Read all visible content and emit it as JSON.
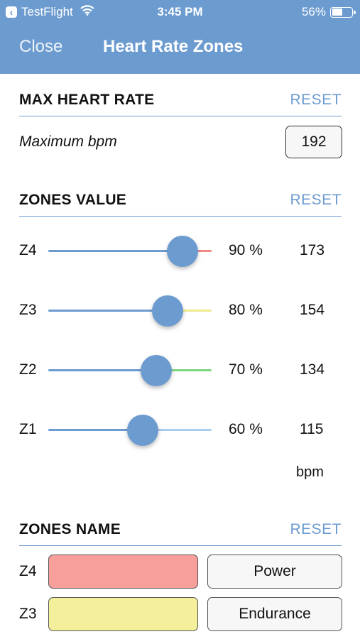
{
  "status_bar": {
    "back_app": "TestFlight",
    "time": "3:45 PM",
    "battery_percent": "56%",
    "battery_level": 0.56,
    "icons": [
      "back-arrow-icon",
      "wifi-icon",
      "battery-icon"
    ]
  },
  "nav": {
    "close_label": "Close",
    "title": "Heart Rate Zones"
  },
  "max_heart_rate": {
    "title": "MAX HEART RATE",
    "reset_label": "RESET",
    "field_label": "Maximum bpm",
    "value": "192"
  },
  "zones_value": {
    "title": "ZONES VALUE",
    "reset_label": "RESET",
    "unit_label": "bpm",
    "zones": [
      {
        "label": "Z4",
        "percent_text": "90 %",
        "bpm": "173",
        "slider_fraction": 0.82,
        "track_color": "#f08a86"
      },
      {
        "label": "Z3",
        "percent_text": "80 %",
        "bpm": "154",
        "slider_fraction": 0.73,
        "track_color": "#eeea8e"
      },
      {
        "label": "Z2",
        "percent_text": "70 %",
        "bpm": "134",
        "slider_fraction": 0.66,
        "track_color": "#7bd67e"
      },
      {
        "label": "Z1",
        "percent_text": "60 %",
        "bpm": "115",
        "slider_fraction": 0.58,
        "track_color": "#a9cbee"
      }
    ]
  },
  "zones_name": {
    "title": "ZONES NAME",
    "reset_label": "RESET",
    "rows": [
      {
        "label": "Z4",
        "color": "#f7a09b",
        "name": "Power"
      },
      {
        "label": "Z3",
        "color": "#f3ef9b",
        "name": "Endurance"
      }
    ]
  },
  "colors": {
    "accent": "#6c9bd0"
  }
}
